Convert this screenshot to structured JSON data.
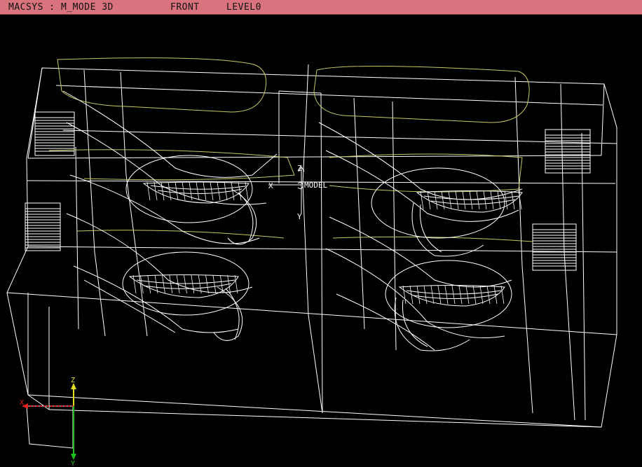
{
  "window": {
    "title": "MACSYS : M_MODE 3D",
    "view": "FRONT",
    "level": "LEVEL0"
  },
  "model_axes": {
    "x_label": "X",
    "y_label": "Y",
    "z_label": "Z",
    "origin_label": "MODEL"
  },
  "triad": {
    "x_label": "X",
    "y_label": "Y",
    "z_label": "Z",
    "colors": {
      "x": "#e02020",
      "y": "#20c020",
      "z": "#e0e020"
    }
  },
  "colors": {
    "background": "#000000",
    "titlebar": "#d9737d",
    "wireframe": "#ffffff",
    "profile": "#c8c864"
  }
}
